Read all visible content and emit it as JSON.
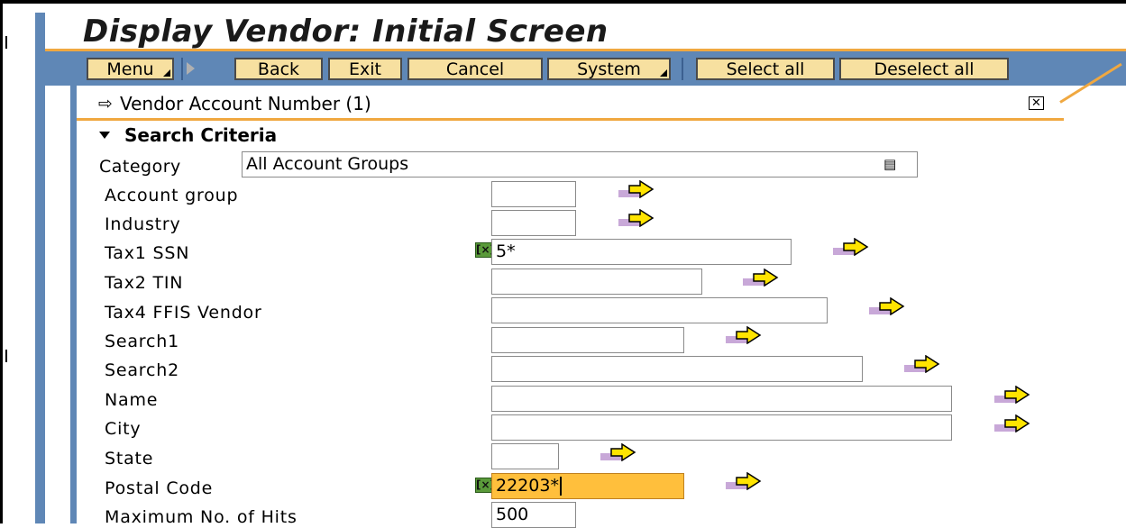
{
  "window": {
    "title": "Display Vendor: Initial Screen"
  },
  "toolbar": {
    "menu": "Menu",
    "back": "Back",
    "exit": "Exit",
    "cancel": "Cancel",
    "system": "System",
    "select_all": "Select all",
    "deselect_all": "Deselect all"
  },
  "dialog": {
    "title": "Vendor Account Number (1)",
    "close_icon": "close-icon",
    "section": "Search Criteria",
    "category": {
      "label": "Category",
      "value": "All Account Groups"
    },
    "fields": [
      {
        "label": "Account group",
        "value": ""
      },
      {
        "label": "Industry",
        "value": ""
      },
      {
        "label": "Tax1 SSN",
        "value": "5*"
      },
      {
        "label": "Tax2 TIN",
        "value": ""
      },
      {
        "label": "Tax4 FFIS Vendor",
        "value": ""
      },
      {
        "label": "Search1",
        "value": ""
      },
      {
        "label": "Search2",
        "value": ""
      },
      {
        "label": "Name",
        "value": ""
      },
      {
        "label": "City",
        "value": ""
      },
      {
        "label": "State",
        "value": ""
      },
      {
        "label": "Postal Code",
        "value": "22203*"
      },
      {
        "label": "Maximum No. of Hits",
        "value": "500"
      }
    ]
  },
  "colors": {
    "frame_blue": "#5f87b6",
    "accent_orange": "#f0a840",
    "button_fill": "#f7e0a0",
    "highlight_field": "#ffbf3c",
    "multiselect_green": "#5a9a3a"
  },
  "icons": {
    "multiple_selection": "multiple-selection-icon",
    "selection_arrow": "arrow-right-icon",
    "dropdown": "dropdown-list-icon",
    "header": "dialog-window-icon"
  }
}
